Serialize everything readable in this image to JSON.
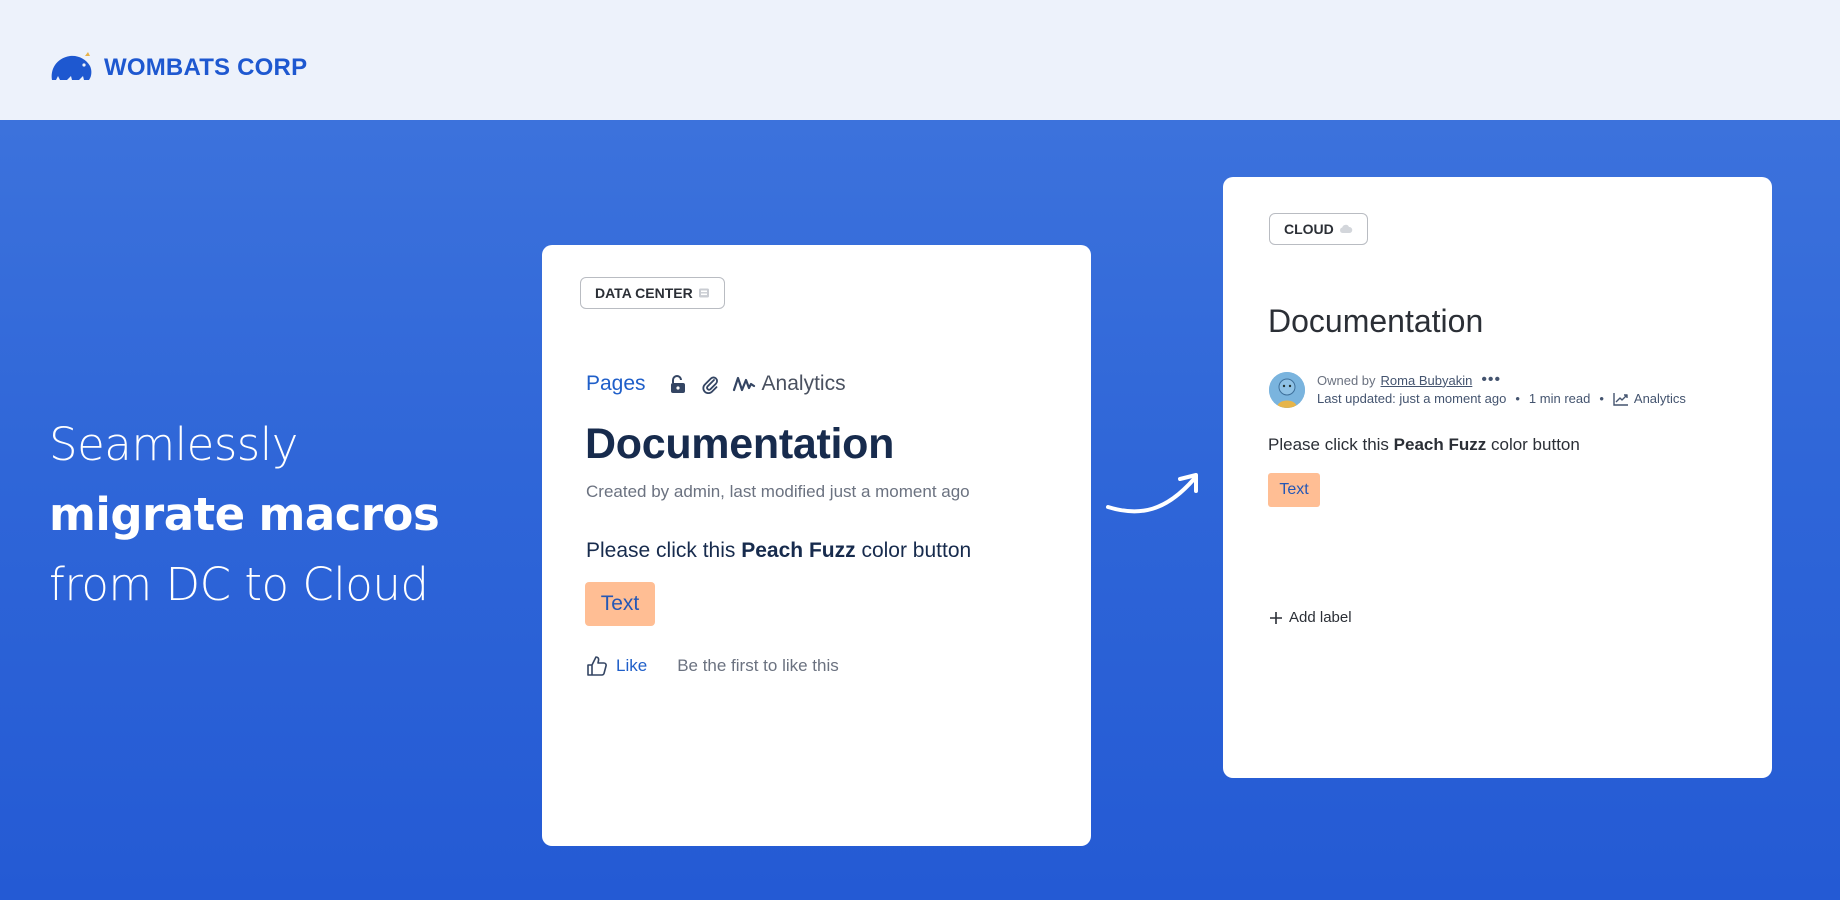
{
  "brand": {
    "name": "WOMBATS CORP",
    "color": "#1e58d0"
  },
  "headline": {
    "part1": "Seamlessly ",
    "bold1": "migrate",
    "bold2": "macros",
    "part2": " from DC to Cloud"
  },
  "dc_card": {
    "badge": "DATA CENTER",
    "badge_icon": "server-icon",
    "toolbar": {
      "pages": "Pages",
      "analytics": "Analytics"
    },
    "title": "Documentation",
    "meta": "Created by admin, last modified just a moment ago",
    "body_prefix": "Please click this ",
    "body_bold": "Peach Fuzz",
    "body_suffix": " color button",
    "button_label": "Text",
    "like_label": "Like",
    "like_text": "Be the first to like this"
  },
  "cloud_card": {
    "badge": "CLOUD",
    "badge_icon": "cloud-icon",
    "title": "Documentation",
    "owned_prefix": "Owned by",
    "owner": "Roma Bubyakin",
    "updated": "Last updated: just a moment ago",
    "read_time": "1 min read",
    "analytics": "Analytics",
    "body_prefix": "Please click this ",
    "body_bold": "Peach Fuzz",
    "body_suffix": " color button",
    "button_label": "Text",
    "add_label": "Add label"
  },
  "colors": {
    "peach_fuzz": "#ffbe94",
    "hero_bg": "#2a63d6",
    "topbar_bg": "#edf2fb"
  }
}
